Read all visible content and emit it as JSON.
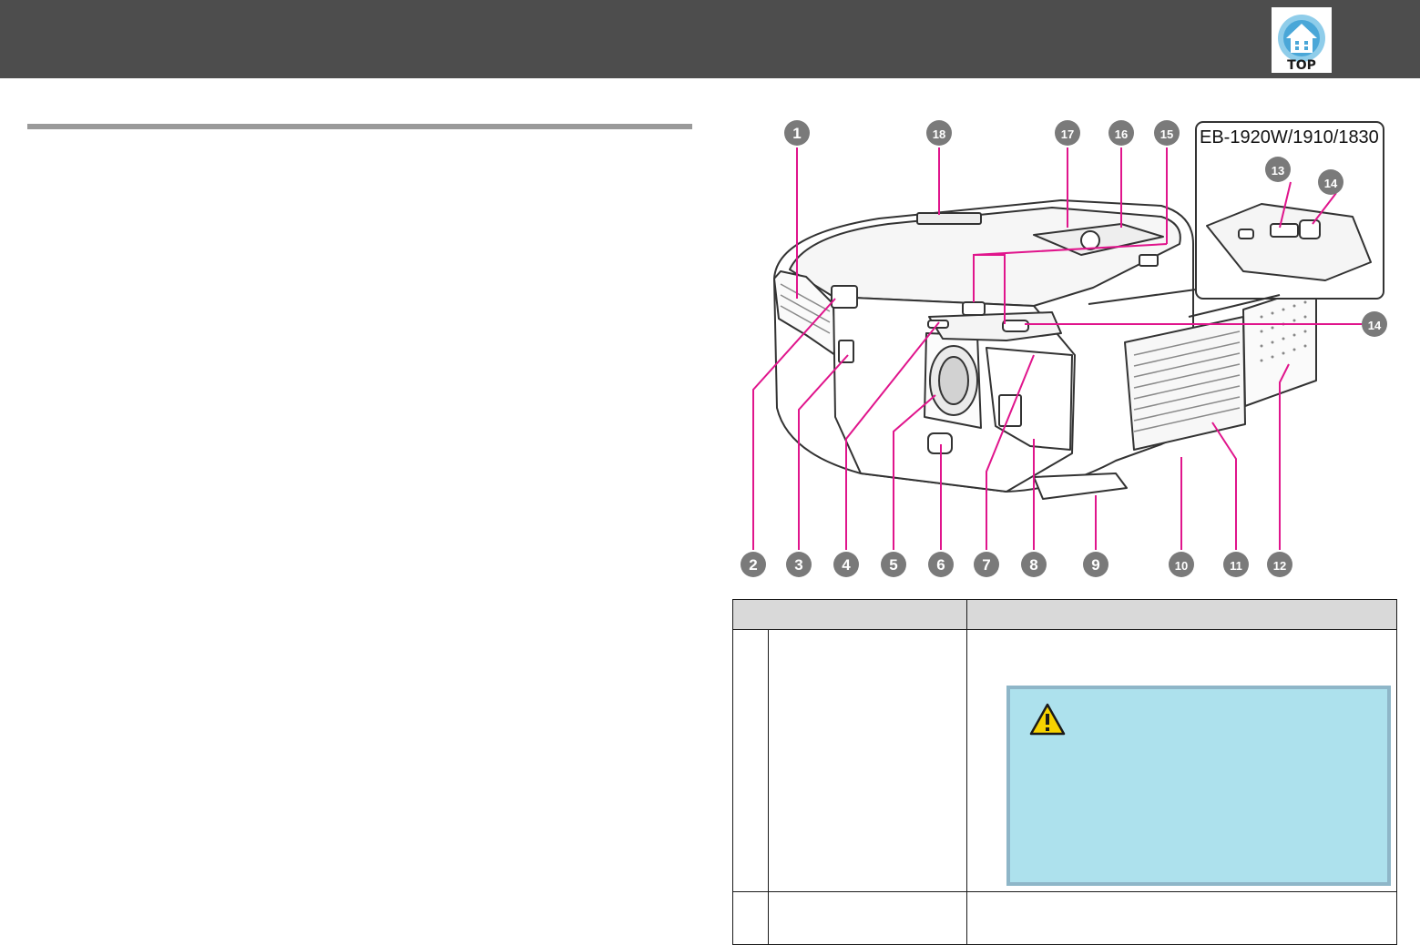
{
  "header": {
    "top_button_label": "TOP",
    "top_icon": "home-icon"
  },
  "figure": {
    "inset_title": "EB-1920W/1910/1830",
    "callouts": [
      "1",
      "2",
      "3",
      "4",
      "5",
      "6",
      "7",
      "8",
      "9",
      "10",
      "11",
      "12",
      "13",
      "14",
      "15",
      "16",
      "17",
      "18"
    ]
  },
  "caution": {
    "icon": "warning-triangle-icon"
  },
  "colors": {
    "header_bar": "#4d4d4d",
    "callout_line": "#e0158c",
    "caution_fill": "#ade1ed",
    "caution_border": "#8eb6c8",
    "table_header": "#d9d9d9"
  }
}
